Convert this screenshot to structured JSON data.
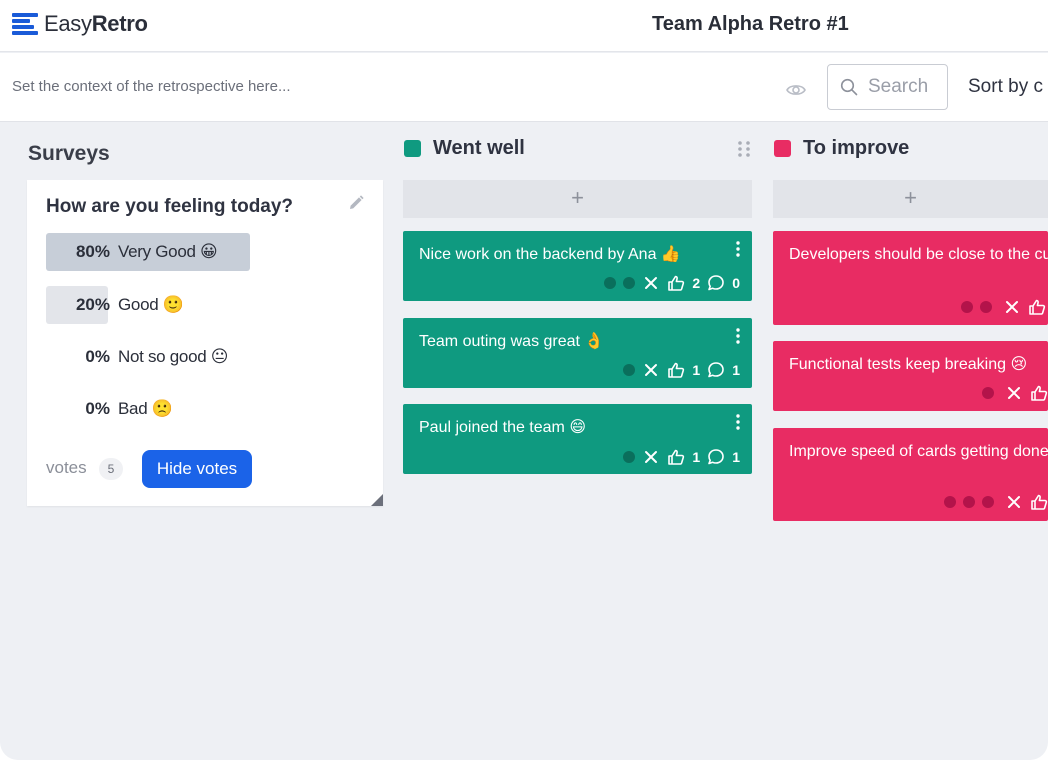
{
  "app": {
    "logo_word1": "Easy",
    "logo_word2": "Retro",
    "board_title": "Team Alpha Retro #1",
    "brand_color": "#1a5bd8"
  },
  "toolbar": {
    "context_placeholder": "Set the context of the retrospective here...",
    "visibility_icon": "eye-icon",
    "search_placeholder": "Search",
    "sort_label": "Sort by c"
  },
  "surveys": {
    "title": "Surveys",
    "question": "How are you feeling today?",
    "options": [
      {
        "pct": "80%",
        "label": "Very Good 😀",
        "fraction": 0.8
      },
      {
        "pct": "20%",
        "label": "Good 🙂",
        "fraction": 0.2
      },
      {
        "pct": "0%",
        "label": "Not so good 😐",
        "fraction": 0
      },
      {
        "pct": "0%",
        "label": "Bad 🙁",
        "fraction": 0
      }
    ],
    "votes_label": "votes",
    "votes_count": "5",
    "hide_votes_label": "Hide votes"
  },
  "columns": [
    {
      "title": "Went well",
      "color": "#0f9a80",
      "add_label": "+",
      "cards": [
        {
          "text": "Nice work on the backend by Ana 👍",
          "dots": 2,
          "likes": "2",
          "comments": "0"
        },
        {
          "text": "Team outing was great 👌",
          "dots": 1,
          "likes": "1",
          "comments": "1"
        },
        {
          "text": "Paul joined the team 😄",
          "dots": 1,
          "likes": "1",
          "comments": "1"
        }
      ]
    },
    {
      "title": "To improve",
      "color": "#e82c63",
      "add_label": "+",
      "cards": [
        {
          "text": "Developers should be close to the customer",
          "dots": 2
        },
        {
          "text": "Functional tests keep breaking 😢",
          "dots": 1
        },
        {
          "text": "Improve speed of cards getting done on Kanban",
          "dots": 3
        }
      ]
    }
  ]
}
